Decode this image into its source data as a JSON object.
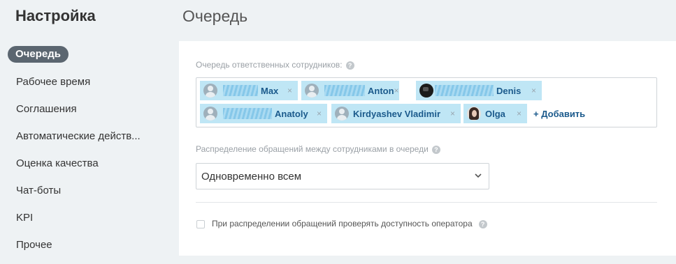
{
  "sidebar": {
    "title": "Настройка",
    "items": [
      {
        "label": "Очередь",
        "active": true
      },
      {
        "label": "Рабочее время"
      },
      {
        "label": "Соглашения"
      },
      {
        "label": "Автоматические действ..."
      },
      {
        "label": "Оценка качества"
      },
      {
        "label": "Чат-боты"
      },
      {
        "label": "KPI"
      },
      {
        "label": "Прочее"
      }
    ]
  },
  "main": {
    "title": "Очередь",
    "queue": {
      "label": "Очередь ответственных сотрудников:",
      "help_icon": "?",
      "employees": [
        {
          "name": "Max",
          "avatar": "default-avatar-icon",
          "close": "×"
        },
        {
          "name": "Anton",
          "avatar": "default-avatar-icon",
          "close": "×"
        },
        {
          "name": "Denis",
          "avatar": "dark-photo-avatar",
          "close": "×"
        },
        {
          "name": "Anatoly",
          "avatar": "default-avatar-icon",
          "close": "×"
        },
        {
          "name": "Kirdyashev Vladimir",
          "avatar": "default-avatar-icon",
          "close": "×"
        },
        {
          "name": "Olga",
          "avatar": "photo-avatar",
          "close": "×"
        }
      ],
      "add_label": "+ Добавить"
    },
    "distribution": {
      "label": "Распределение обращений между сотрудниками в очереди",
      "help_icon": "?",
      "selected": "Одновременно всем"
    },
    "availability_check": {
      "label": "При распределении обращений проверять доступность оператора",
      "checked": false,
      "help_icon": "?"
    }
  },
  "colors": {
    "page_bg": "#eef2f4",
    "chip_bg": "#bfe6f5",
    "link": "#1b5a8c",
    "active_menu_bg": "#5b6670"
  }
}
